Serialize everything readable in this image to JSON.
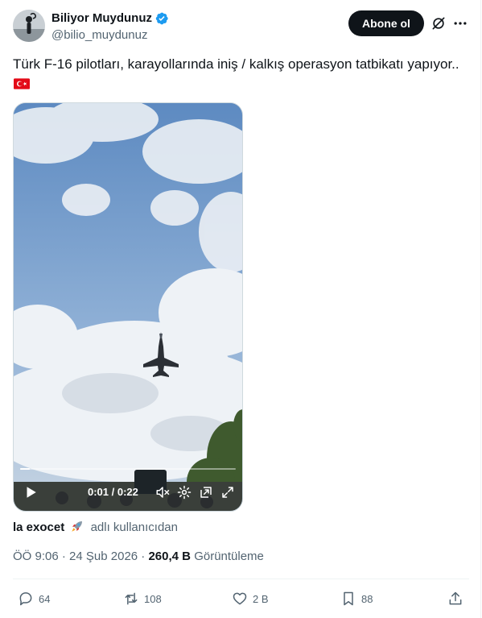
{
  "author": {
    "display_name": "Biliyor Muydunuz",
    "handle": "@bilio_muydunuz",
    "verified": true
  },
  "follow_button": {
    "label": "Abone ol"
  },
  "icons": {
    "grok": "grok-icon",
    "more": "more-icon",
    "verified": "verified-badge-icon"
  },
  "tweet": {
    "text": "Türk F-16 pilotları, karayollarında iniş / kalkış operasyon tatbikatı yapıyor.."
  },
  "video": {
    "time_label": "0:01 / 0:22",
    "progress_fraction": 0.045
  },
  "attribution": {
    "user": "la exocet",
    "suffix": "adlı kullanıcıdan"
  },
  "meta": {
    "time": "ÖÖ 9:06",
    "date": "24 Şub 2026",
    "views_count": "260,4 B",
    "views_label": "Görüntüleme"
  },
  "actions": {
    "replies": "64",
    "reposts": "108",
    "likes": "2 B",
    "bookmarks": "88"
  },
  "colors": {
    "accent": "#1d9bf0",
    "text_primary": "#0f1419",
    "text_secondary": "#536471",
    "button_dark": "#0f1419"
  }
}
